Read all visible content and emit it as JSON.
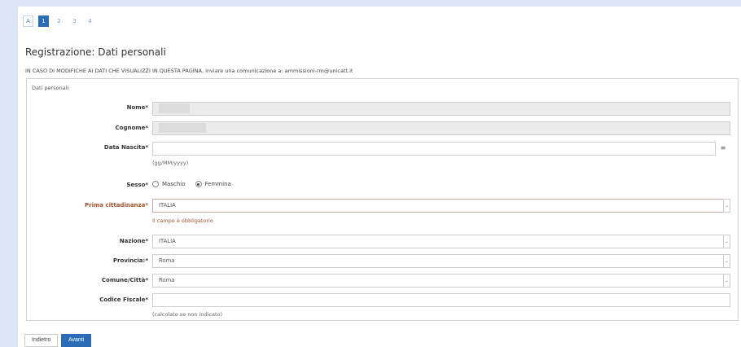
{
  "steps": [
    {
      "label": "A",
      "state": "boxed"
    },
    {
      "label": "1",
      "state": "active"
    },
    {
      "label": "2",
      "state": "plain"
    },
    {
      "label": "3",
      "state": "plain"
    },
    {
      "label": "4",
      "state": "plain"
    }
  ],
  "title": "Registrazione: Dati personali",
  "notice": "IN CASO DI MODIFICHE AI DATI CHE VISUALIZZI IN QUESTA PAGINA, inviare una comunicazione a: ammissioni-rm@unicatt.it",
  "fieldset_legend": "Dati personali",
  "form": {
    "nome": {
      "label": "Nome*",
      "value": ""
    },
    "cognome": {
      "label": "Cognome*",
      "value": ""
    },
    "data_nascita": {
      "label": "Data Nascita*",
      "value": "",
      "hint": "(gg/MM/yyyy)",
      "icon": "calendar-icon"
    },
    "sesso": {
      "label": "Sesso*",
      "options": [
        "Maschio",
        "Femmina"
      ],
      "selected": "Femmina"
    },
    "prima_cittadinanza": {
      "label": "Prima cittadinanza*",
      "value": "ITALIA",
      "error": "Il campo è obbligatorio"
    },
    "nazione": {
      "label": "Nazione*",
      "value": "ITALIA"
    },
    "provincia": {
      "label": "Provincia:*",
      "value": "Roma"
    },
    "comune": {
      "label": "Comune/Città*",
      "value": "Roma"
    },
    "codice_fiscale": {
      "label": "Codice Fiscale*",
      "value": "",
      "hint": "(calcolato se non indicato)"
    }
  },
  "buttons": {
    "back": "Indietro",
    "next": "Avanti"
  },
  "colors": {
    "accent": "#2a6cb6",
    "error": "#a0522d",
    "background": "#dde6f5"
  }
}
